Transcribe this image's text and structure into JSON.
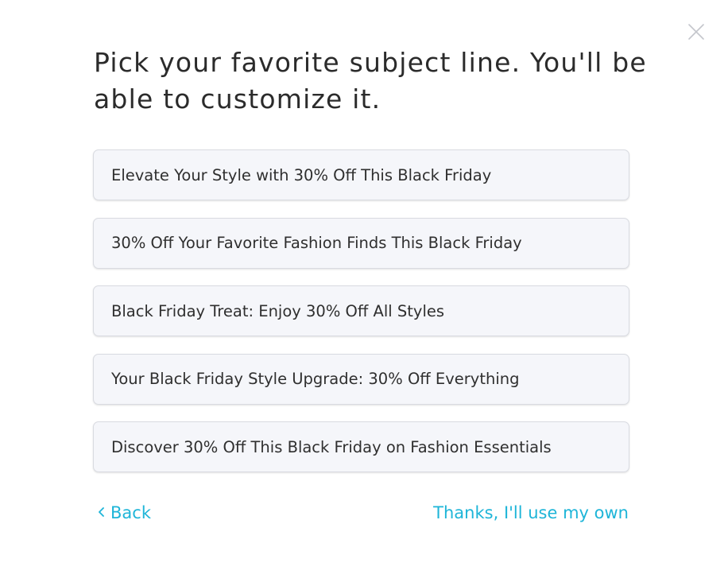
{
  "modal": {
    "title": "Pick your favorite subject line. You'll be able to customize it.",
    "options": [
      {
        "label": "Elevate Your Style with 30% Off This Black Friday"
      },
      {
        "label": "30% Off Your Favorite Fashion Finds This Black Friday"
      },
      {
        "label": "Black Friday Treat: Enjoy 30% Off All Styles"
      },
      {
        "label": "Your Black Friday Style Upgrade: 30% Off Everything"
      },
      {
        "label": "Discover 30% Off This Black Friday on Fashion Essentials"
      }
    ],
    "back_label": "Back",
    "own_label": "Thanks, I'll use my own",
    "icons": {
      "close": "close-icon",
      "back": "chevron-left-icon"
    },
    "colors": {
      "link": "#1eb5d8",
      "option_bg": "#f5f6fa",
      "option_border": "#d9dbe1",
      "text": "#2b2b2b"
    }
  }
}
